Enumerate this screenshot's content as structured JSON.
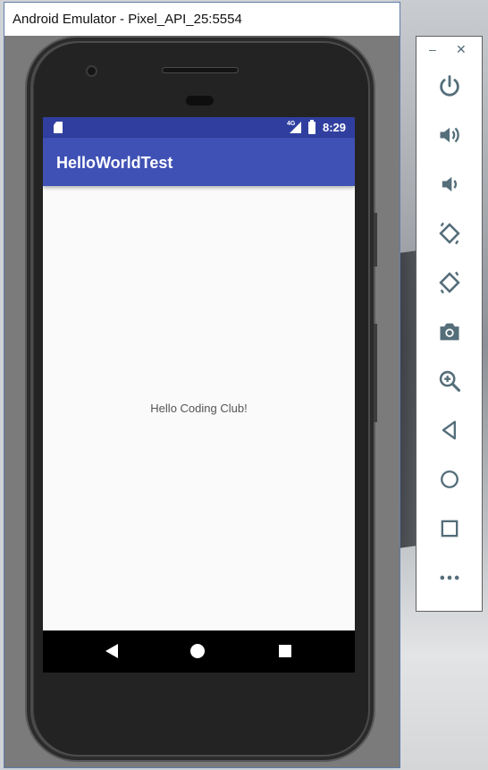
{
  "window": {
    "title": "Android Emulator - Pixel_API_25:5554"
  },
  "device": {
    "status_bar": {
      "network": "4G",
      "time": "8:29",
      "icons": [
        "sd-card-icon",
        "signal-icon",
        "battery-charging-icon"
      ]
    },
    "app": {
      "title": "HelloWorldTest",
      "message": "Hello Coding Club!"
    },
    "nav_bar": {
      "icons": [
        "back-icon",
        "home-icon",
        "recents-icon"
      ]
    }
  },
  "extended_controls": {
    "window_buttons": [
      "–",
      "✕"
    ],
    "buttons": [
      {
        "name": "power",
        "icon": "power-icon"
      },
      {
        "name": "volume-up",
        "icon": "volume-up-icon"
      },
      {
        "name": "volume-down",
        "icon": "volume-down-icon"
      },
      {
        "name": "rotate-left",
        "icon": "rotate-left-icon"
      },
      {
        "name": "rotate-right",
        "icon": "rotate-right-icon"
      },
      {
        "name": "screenshot",
        "icon": "camera-icon"
      },
      {
        "name": "zoom",
        "icon": "zoom-in-icon"
      },
      {
        "name": "back",
        "icon": "back-icon"
      },
      {
        "name": "home",
        "icon": "home-icon"
      },
      {
        "name": "overview",
        "icon": "overview-icon"
      },
      {
        "name": "more",
        "icon": "more-icon"
      }
    ]
  },
  "colors": {
    "status_bar": "#303f9f",
    "app_bar": "#3f51b5",
    "control_icon": "#546e7a"
  }
}
